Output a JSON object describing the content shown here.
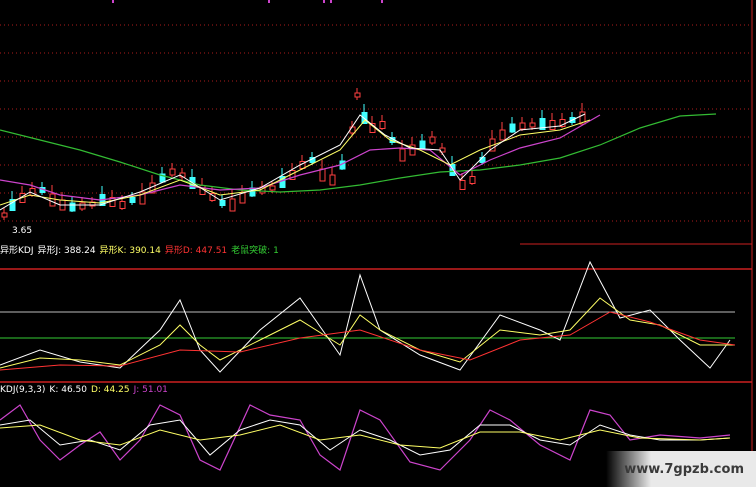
{
  "main": {
    "low_marker": "3.65"
  },
  "kdj_custom": {
    "title": "异形KDJ",
    "j_label": "异形J: 388.24",
    "k_label": "异形K: 390.14",
    "d_label": "异形D: 447.51",
    "signal_label": "老鼠突破: 1",
    "colors": {
      "title": "#ffffff",
      "j": "#ffffff",
      "k": "#ffff66",
      "d": "#ff3333",
      "signal": "#33cc33"
    }
  },
  "kdj_std": {
    "title": "KDJ(9,3,3)",
    "k_label": "K: 46.50",
    "d_label": "D: 44.25",
    "j_label": "J: 51.01",
    "colors": {
      "title": "#ffffff",
      "k": "#ffffff",
      "d": "#ffff66",
      "j": "#cc44cc"
    }
  },
  "watermark": "www.7gpzb.com",
  "colors": {
    "up": "#ff4040",
    "down": "#40ffff",
    "ma_white": "#ffffff",
    "ma_yellow": "#ffff66",
    "ma_magenta": "#cc44cc",
    "ma_green": "#33bb33",
    "grid_red": "#cc2020"
  }
}
